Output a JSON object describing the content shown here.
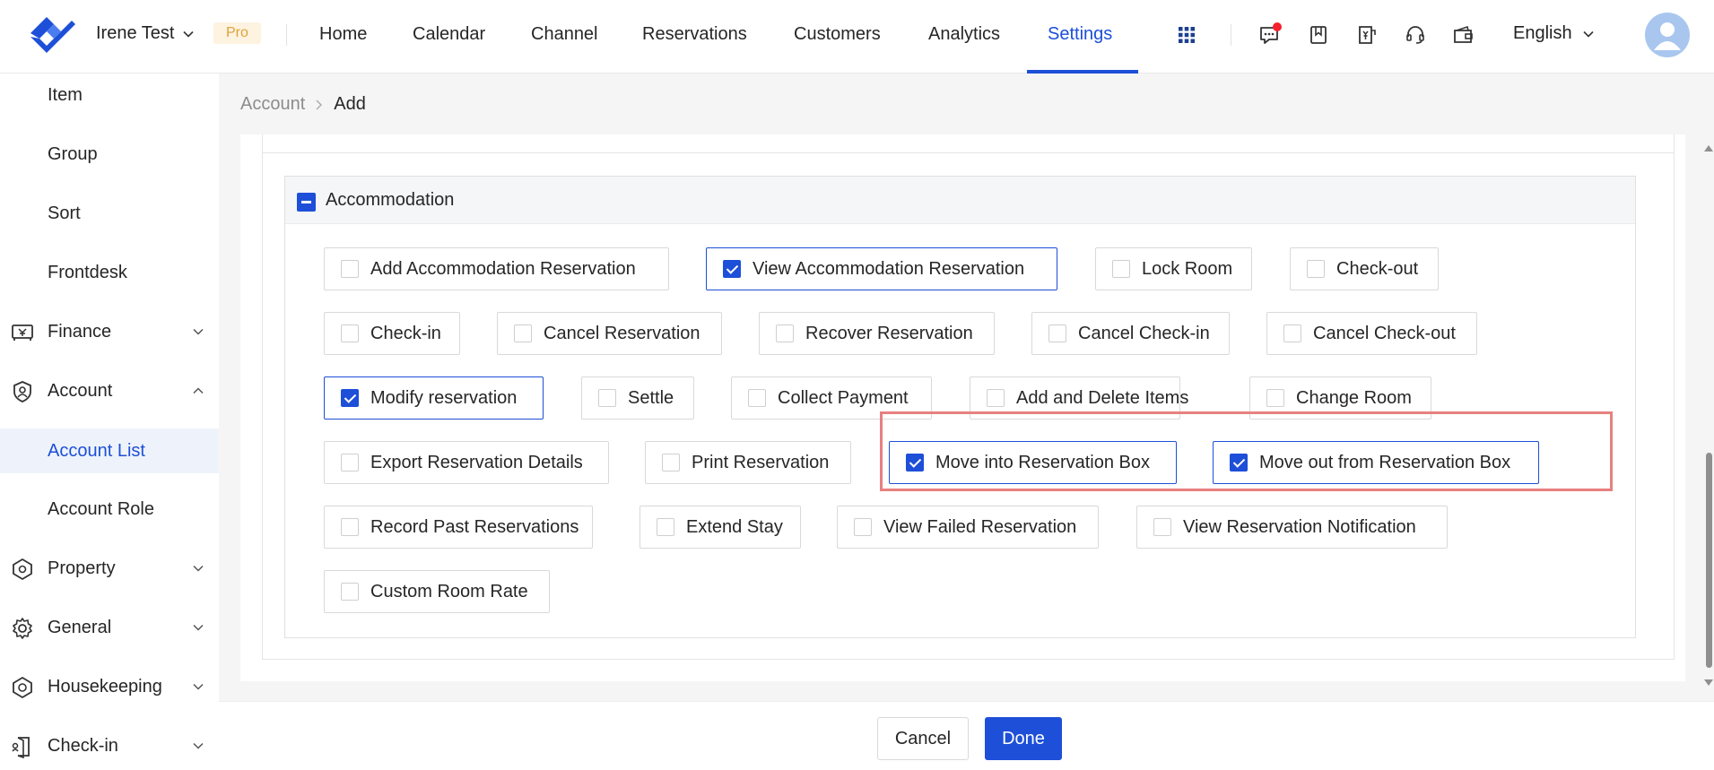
{
  "header": {
    "account_name": "Irene Test",
    "badge": "Pro",
    "nav": [
      "Home",
      "Calendar",
      "Channel",
      "Reservations",
      "Customers",
      "Analytics",
      "Settings"
    ],
    "active_nav": "Settings",
    "language": "English",
    "accent_color": "#1d4fd8"
  },
  "sidebar": {
    "items": [
      {
        "label": "Item",
        "type": "sub"
      },
      {
        "label": "Group",
        "type": "sub"
      },
      {
        "label": "Sort",
        "type": "sub"
      },
      {
        "label": "Frontdesk",
        "type": "sub"
      },
      {
        "label": "Finance",
        "type": "group",
        "icon": "finance-icon",
        "expanded": false
      },
      {
        "label": "Account",
        "type": "group",
        "icon": "account-icon",
        "expanded": true
      },
      {
        "label": "Account List",
        "type": "sub",
        "active": true
      },
      {
        "label": "Account Role",
        "type": "sub"
      },
      {
        "label": "Property",
        "type": "group",
        "icon": "property-icon",
        "expanded": false
      },
      {
        "label": "General",
        "type": "group",
        "icon": "gear-icon",
        "expanded": false
      },
      {
        "label": "Housekeeping",
        "type": "group",
        "icon": "housekeeping-icon",
        "expanded": false
      },
      {
        "label": "Check-in",
        "type": "group",
        "icon": "check-in-icon",
        "expanded": false
      }
    ]
  },
  "breadcrumb": {
    "parent": "Account",
    "current": "Add"
  },
  "section": {
    "title": "Accommodation",
    "state": "indeterminate",
    "permissions": [
      {
        "label": "Add Accommodation Reservation",
        "checked": false
      },
      {
        "label": "View Accommodation Reservation",
        "checked": true
      },
      {
        "label": "Lock Room",
        "checked": false
      },
      {
        "label": "Check-out",
        "checked": false
      },
      {
        "label": "Check-in",
        "checked": false
      },
      {
        "label": "Cancel Reservation",
        "checked": false
      },
      {
        "label": "Recover Reservation",
        "checked": false
      },
      {
        "label": "Cancel Check-in",
        "checked": false
      },
      {
        "label": "Cancel Check-out",
        "checked": false
      },
      {
        "label": "Modify reservation",
        "checked": true
      },
      {
        "label": "Settle",
        "checked": false
      },
      {
        "label": "Collect Payment",
        "checked": false
      },
      {
        "label": "Add and Delete Items",
        "checked": false
      },
      {
        "label": "Change Room",
        "checked": false
      },
      {
        "label": "Export Reservation Details",
        "checked": false
      },
      {
        "label": "Print Reservation",
        "checked": false
      },
      {
        "label": "Move into Reservation Box",
        "checked": true
      },
      {
        "label": "Move out from Reservation Box",
        "checked": true
      },
      {
        "label": "Record Past Reservations",
        "checked": false
      },
      {
        "label": "Extend Stay",
        "checked": false
      },
      {
        "label": "View Failed Reservation",
        "checked": false
      },
      {
        "label": "View Reservation Notification",
        "checked": false
      },
      {
        "label": "Custom Room Rate",
        "checked": false
      }
    ]
  },
  "footer": {
    "cancel": "Cancel",
    "done": "Done"
  }
}
